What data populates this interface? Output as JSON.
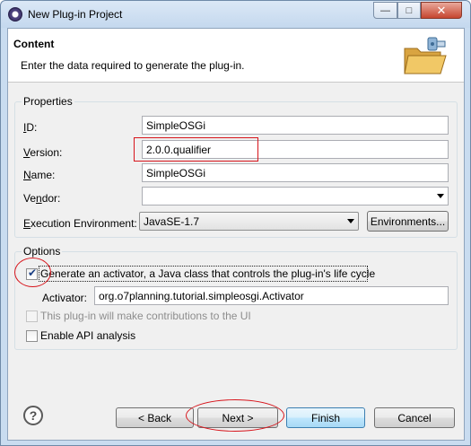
{
  "window": {
    "title": "New Plug-in Project"
  },
  "header": {
    "title": "Content",
    "description": "Enter the data required to generate the plug-in."
  },
  "properties": {
    "legend": "Properties",
    "id_label": "ID:",
    "id_value": "SimpleOSGi",
    "version_label": "Version:",
    "version_value": "2.0.0.qualifier",
    "name_label": "Name:",
    "name_value": "SimpleOSGi",
    "vendor_label": "Vendor:",
    "vendor_value": "",
    "env_label": "Execution Environment:",
    "env_value": "JavaSE-1.7",
    "environments_button": "Environments..."
  },
  "options": {
    "legend": "Options",
    "generate_activator_label": "Generate an activator, a Java class that controls the plug-in's life cycle",
    "generate_activator_checked": true,
    "activator_label": "Activator:",
    "activator_value": "org.o7planning.tutorial.simpleosgi.Activator",
    "ui_contrib_label": "This plug-in will make contributions to the UI",
    "ui_contrib_checked": false,
    "api_analysis_label": "Enable API analysis",
    "api_analysis_checked": false
  },
  "buttons": {
    "back": "< Back",
    "next": "Next >",
    "finish": "Finish",
    "cancel": "Cancel"
  },
  "colors": {
    "annotation": "#d7141b",
    "titlebar": "#c9dcf0"
  }
}
